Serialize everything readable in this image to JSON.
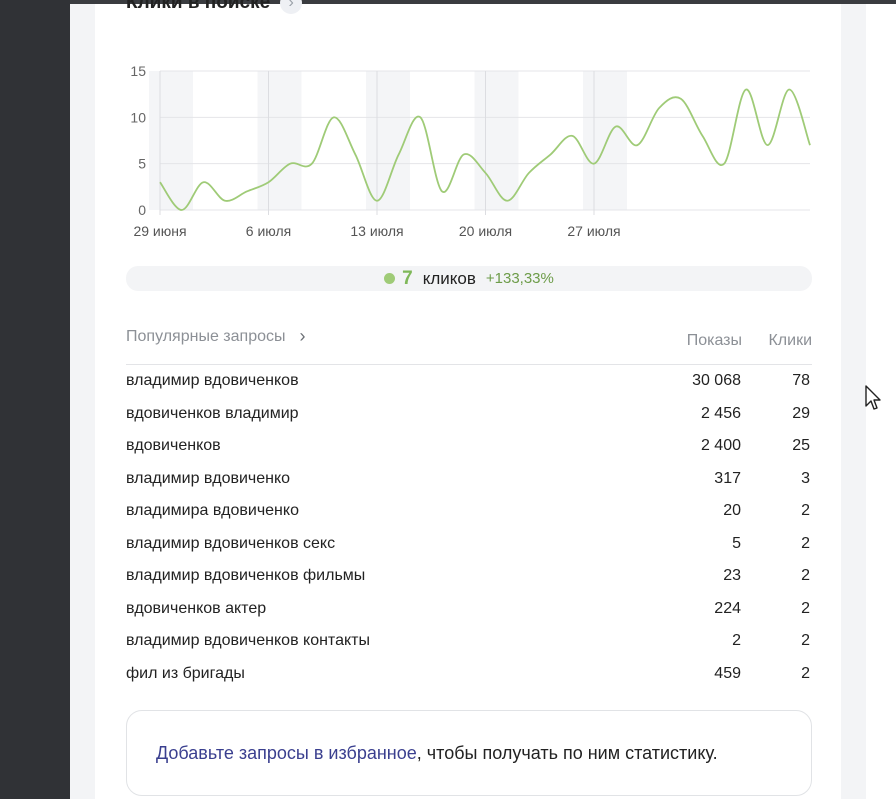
{
  "section": {
    "title": "Клики в поиске",
    "arrow": "›"
  },
  "chart_data": {
    "type": "line",
    "x": [
      "29.06",
      "30.06",
      "01.07",
      "02.07",
      "03.07",
      "04.07",
      "05.07",
      "06.07",
      "07.07",
      "08.07",
      "09.07",
      "10.07",
      "11.07",
      "12.07",
      "13.07",
      "14.07",
      "15.07",
      "16.07",
      "17.07",
      "18.07",
      "19.07",
      "20.07",
      "21.07",
      "22.07",
      "23.07",
      "24.07",
      "25.07",
      "26.07",
      "27.07",
      "28.07"
    ],
    "values": [
      3,
      0,
      3,
      1,
      2,
      3,
      5,
      5,
      10,
      6,
      1,
      6,
      10,
      2,
      6,
      4,
      1,
      4,
      6,
      8,
      5,
      9,
      7,
      11,
      12,
      8,
      5,
      13,
      7,
      13
    ],
    "end_value": 7,
    "tick_labels": [
      "29 июня",
      "6 июля",
      "13 июля",
      "20 июля",
      "27 июля"
    ],
    "tick_index": [
      0,
      5,
      10,
      15,
      20
    ],
    "y_ticks": [
      "0",
      "5",
      "10",
      "15"
    ],
    "ylim": [
      0,
      15
    ],
    "grid": true,
    "color": "#9fcb77"
  },
  "summary": {
    "value": "7",
    "unit": "кликов",
    "change": "+133,33%"
  },
  "queries": {
    "title": "Популярные запросы",
    "chevron": "›",
    "col_shows": "Показы",
    "col_clicks": "Клики",
    "rows": [
      {
        "query": "владимир вдовиченков",
        "shows": "30 068",
        "clicks": "78"
      },
      {
        "query": "вдовиченков владимир",
        "shows": "2 456",
        "clicks": "29"
      },
      {
        "query": "вдовиченков",
        "shows": "2 400",
        "clicks": "25"
      },
      {
        "query": "владимир вдовиченко",
        "shows": "317",
        "clicks": "3"
      },
      {
        "query": "владимира вдовиченко",
        "shows": "20",
        "clicks": "2"
      },
      {
        "query": "владимир вдовиченков секс",
        "shows": "5",
        "clicks": "2"
      },
      {
        "query": "владимир вдовиченков фильмы",
        "shows": "23",
        "clicks": "2"
      },
      {
        "query": "вдовиченков актер",
        "shows": "224",
        "clicks": "2"
      },
      {
        "query": "владимир вдовиченков контакты",
        "shows": "2",
        "clicks": "2"
      },
      {
        "query": "фил из бригады",
        "shows": "459",
        "clicks": "2"
      }
    ]
  },
  "promo": {
    "link_text": "Добавьте запросы в избранное",
    "rest_text": ", чтобы получать по ним статистику."
  }
}
